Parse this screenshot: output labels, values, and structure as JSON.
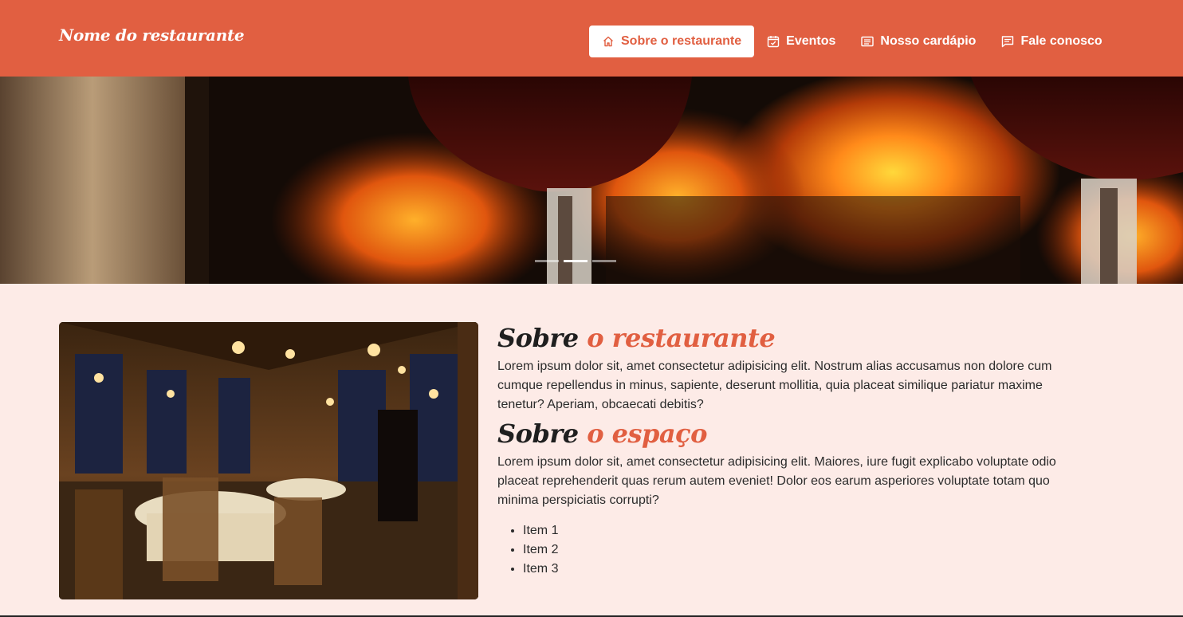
{
  "navbar": {
    "brand": "Nome do restaurante",
    "items": [
      {
        "label": "Sobre o restaurante",
        "icon": "home-icon",
        "active": true
      },
      {
        "label": "Eventos",
        "icon": "calendar-check-icon",
        "active": false
      },
      {
        "label": "Nosso cardápio",
        "icon": "menu-list-icon",
        "active": false
      },
      {
        "label": "Fale conosco",
        "icon": "chat-icon",
        "active": false
      }
    ]
  },
  "hero": {
    "slide_count": 3,
    "active_slide": 2
  },
  "about": {
    "title_part1": "Sobre",
    "title_part2": "o restaurante",
    "text": "Lorem ipsum dolor sit, amet consectetur adipisicing elit. Nostrum alias accusamus non dolore cum cumque repellendus in minus, sapiente, deserunt mollitia, quia placeat similique pariatur maxime tenetur? Aperiam, obcaecati debitis?"
  },
  "space": {
    "title_part1": "Sobre",
    "title_part2": "o espaço",
    "text": "Lorem ipsum dolor sit, amet consectetur adipisicing elit. Maiores, iure fugit explicabo voluptate odio placeat reprehenderit quas rerum autem eveniet! Dolor eos earum asperiores voluptate totam quo minima perspiciatis corrupti?",
    "items": [
      "Item 1",
      "Item 2",
      "Item 3"
    ]
  },
  "colors": {
    "brand": "#e15f41",
    "background": "#fdebe7"
  }
}
